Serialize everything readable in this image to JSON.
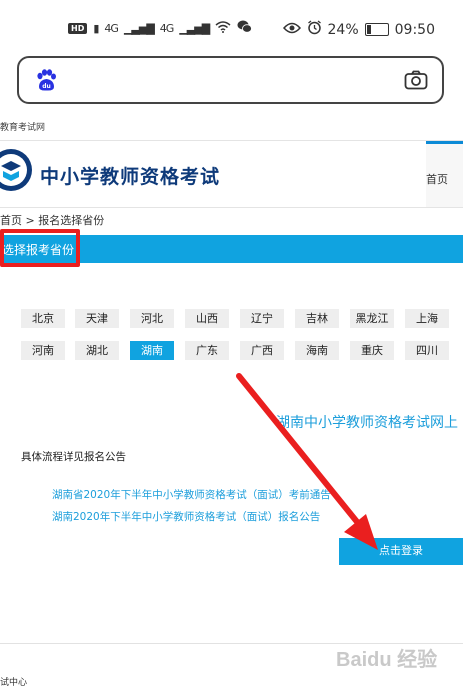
{
  "status_bar": {
    "hd_badge": "HD",
    "network_1": "4G",
    "network_2": "4G",
    "battery_percent": "24%",
    "battery_level": 0.24,
    "time": "09:50"
  },
  "site_name": "教育考试网",
  "header": {
    "title": "中小学教师资格考试",
    "nav_first": "首页"
  },
  "breadcrumb": "首页 > 报名选择省份",
  "section_title": "选择报考省份",
  "provinces": [
    "北京",
    "天津",
    "河北",
    "山西",
    "辽宁",
    "吉林",
    "黑龙江",
    "上海",
    "河南",
    "湖北",
    "湖南",
    "广东",
    "广西",
    "海南",
    "重庆",
    "四川"
  ],
  "selected_province": "湖南",
  "region_title": "湖南中小学教师资格考试网上",
  "process_text": "具体流程详见报名公告",
  "notices": [
    "湖南省2020年下半年中小学教师资格考试（面试）考前通告",
    "湖南2020年下半年中小学教师资格考试（面试）报名公告"
  ],
  "login_button": "点击登录",
  "footer_text": "试中心",
  "watermark": "Baidu 经验",
  "colors": {
    "accent": "#10a3e0",
    "header_title": "#0e3a7a",
    "annotation": "#ea1f1f"
  }
}
